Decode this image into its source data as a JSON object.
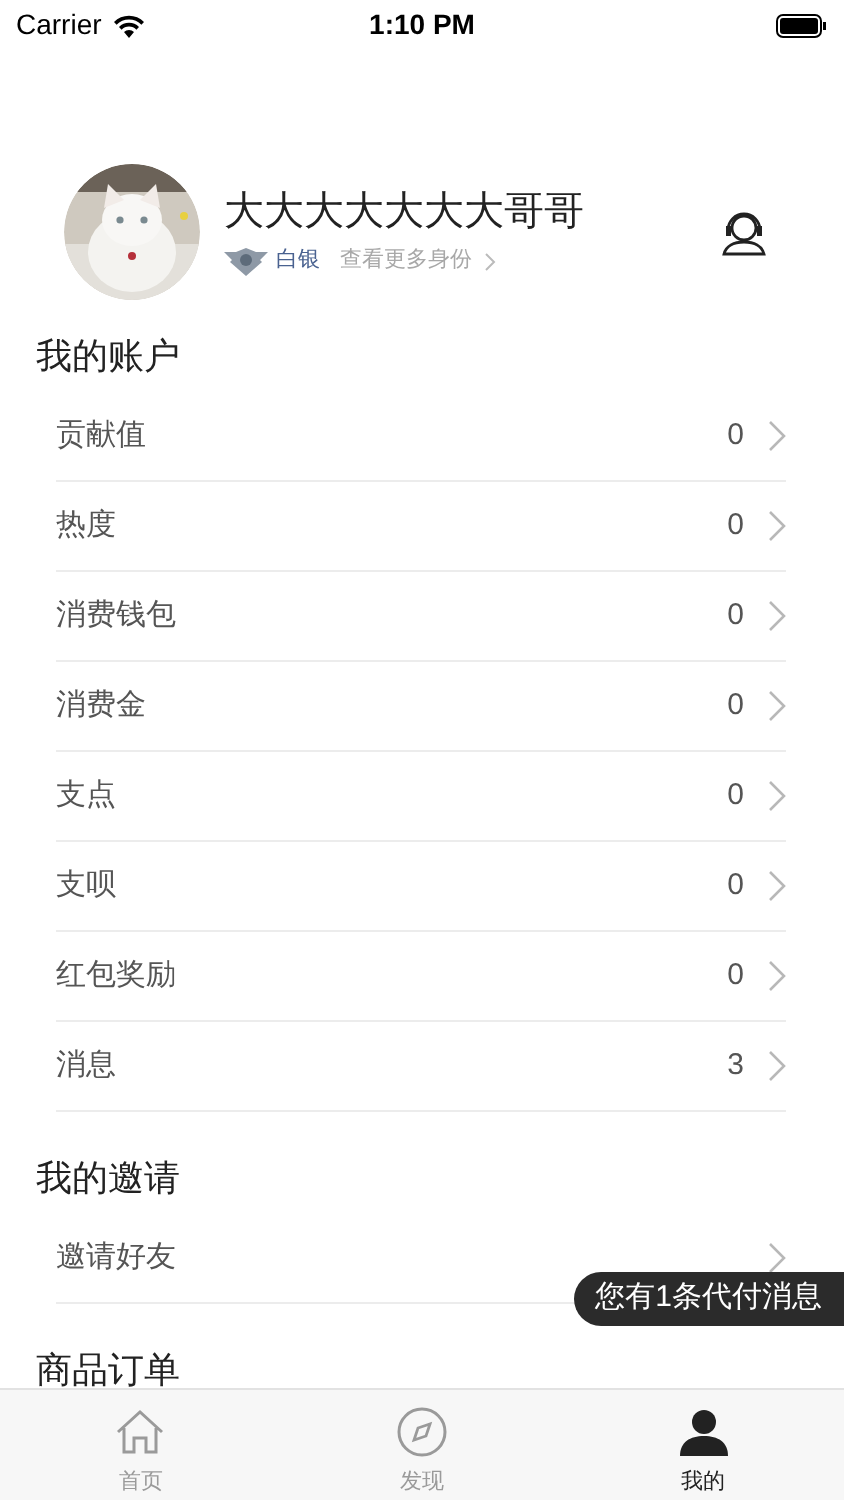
{
  "status_bar": {
    "carrier": "Carrier",
    "time": "1:10 PM"
  },
  "profile": {
    "name": "大大大大大大大哥哥",
    "level": "白银",
    "more": "查看更多身份"
  },
  "sections": [
    {
      "title": "我的账户",
      "rows": [
        {
          "label": "贡献值",
          "value": "0"
        },
        {
          "label": "热度",
          "value": "0"
        },
        {
          "label": "消费钱包",
          "value": "0"
        },
        {
          "label": "消费金",
          "value": "0"
        },
        {
          "label": "支点",
          "value": "0"
        },
        {
          "label": "支呗",
          "value": "0"
        },
        {
          "label": "红包奖励",
          "value": "0"
        },
        {
          "label": "消息",
          "value": "3"
        }
      ]
    },
    {
      "title": "我的邀请",
      "rows": [
        {
          "label": "邀请好友"
        }
      ]
    },
    {
      "title": "商品订单"
    }
  ],
  "toast": "您有1条代付消息",
  "tabs": [
    {
      "label": "首页",
      "selected": false
    },
    {
      "label": "发现",
      "selected": false
    },
    {
      "label": "我的",
      "selected": true
    }
  ]
}
